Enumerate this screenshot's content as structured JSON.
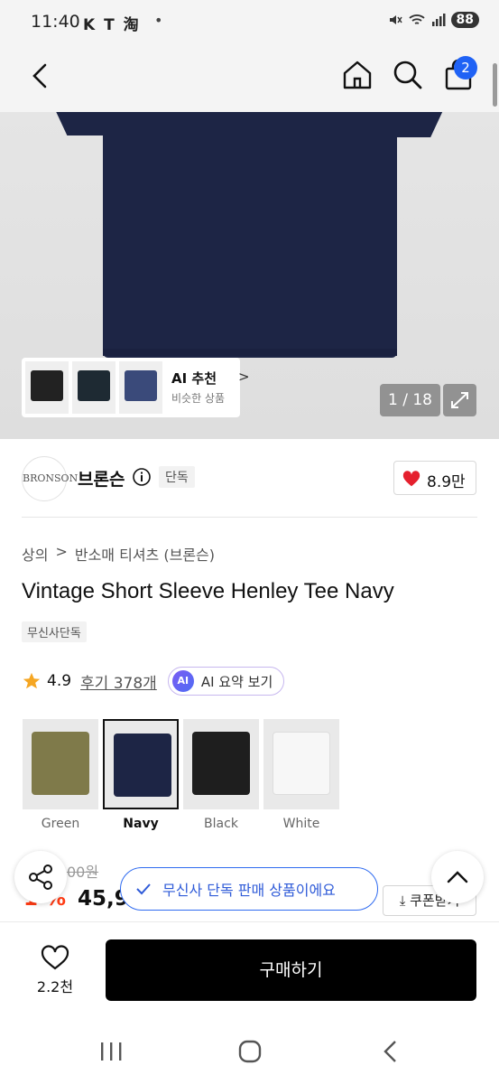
{
  "status_bar": {
    "time": "11:40",
    "left_icons": "K T 淘",
    "dot": "•",
    "battery": "88"
  },
  "header": {
    "cart_count": "2"
  },
  "gallery": {
    "ai_title": "AI 추천",
    "ai_subtitle": "비슷한 상품",
    "ai_chevron": ">",
    "counter": "1 / 18"
  },
  "brand": {
    "logo_text": "BRONSON",
    "name": "브론슨",
    "tag": "단독",
    "likes": "8.9만"
  },
  "breadcrumb": {
    "category": "상의",
    "separator": ">",
    "subcategory": "반소매 티셔츠 (브론슨)"
  },
  "product": {
    "title": "Vintage Short Sleeve Henley Tee Navy",
    "exclusive_tag": "무신사단독"
  },
  "rating": {
    "score": "4.9",
    "reviews": "후기 378개",
    "ai_badge": "AI",
    "ai_summary": "AI 요약 보기"
  },
  "colors": [
    {
      "label": "Green",
      "swatch": "#7f7a4a",
      "selected": false
    },
    {
      "label": "Navy",
      "swatch": "#1d2545",
      "selected": true
    },
    {
      "label": "Black",
      "swatch": "#1e1e1e",
      "selected": false
    },
    {
      "label": "White",
      "swatch": "#f4f4f4",
      "selected": false
    }
  ],
  "price": {
    "old_price": "00원",
    "discount": "1 %",
    "current": "45,9",
    "coupon": "쿠폰받기"
  },
  "toast": {
    "text": "무신사 단독 판매 상품이에요"
  },
  "bottom": {
    "wish_count": "2.2천",
    "buy_label": "구매하기"
  },
  "accent": {
    "brand_blue": "#1f62f5",
    "discount_red": "#ff3b14",
    "like_red": "#e5202e"
  }
}
